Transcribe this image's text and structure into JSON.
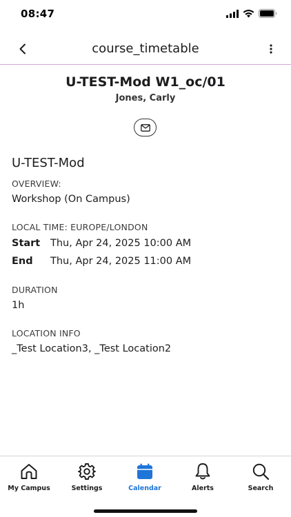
{
  "status_bar": {
    "time": "08:47"
  },
  "nav": {
    "title": "course_timetable",
    "border_color": "#d9a7d8"
  },
  "event": {
    "title": "U-TEST-Mod W1_oc/01",
    "lecturer": "Jones, Carly"
  },
  "details": {
    "module": "U-TEST-Mod",
    "overview_label": "OVERVIEW:",
    "overview_value": "Workshop (On Campus)",
    "local_time_label": "LOCAL TIME: EUROPE/LONDON",
    "start_label": "Start",
    "start_value": "Thu, Apr 24, 2025 10:00 AM",
    "end_label": "End",
    "end_value": "Thu, Apr 24, 2025 11:00 AM",
    "duration_label": "DURATION",
    "duration_value": "1h",
    "location_label": "LOCATION INFO",
    "location_value": "_Test Location3, _Test Location2"
  },
  "tab_bar": {
    "active_color": "#1f75d8",
    "tabs": [
      {
        "label": "My Campus",
        "icon": "home-icon"
      },
      {
        "label": "Settings",
        "icon": "gear-icon"
      },
      {
        "label": "Calendar",
        "icon": "calendar-icon",
        "active": true
      },
      {
        "label": "Alerts",
        "icon": "bell-icon"
      },
      {
        "label": "Search",
        "icon": "search-icon"
      }
    ]
  }
}
